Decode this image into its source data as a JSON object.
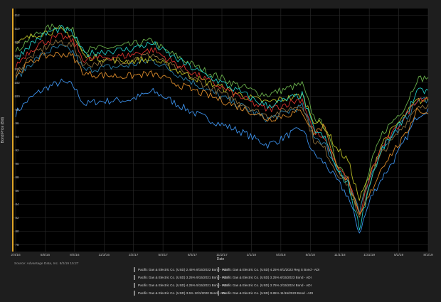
{
  "chart_data": {
    "type": "line",
    "xlabel": "Date",
    "ylabel": "Bond Price (Bid)",
    "source": "Source: Advantage Data, Inc. 8/2/19 15:27",
    "x_ticks": [
      "2/4/16",
      "5/5/16",
      "8/4/16",
      "11/3/16",
      "2/2/17",
      "5/4/17",
      "8/3/17",
      "11/2/17",
      "2/1/18",
      "5/3/18",
      "8/2/18",
      "11/1/18",
      "1/31/19",
      "5/2/19",
      "8/1/19"
    ],
    "y_ticks": [
      78,
      80,
      82,
      84,
      86,
      88,
      90,
      92,
      94,
      96,
      98,
      100,
      102,
      104,
      106,
      108,
      110,
      112
    ],
    "ylim": [
      77,
      113
    ],
    "grid": true,
    "legend_position": "bottom",
    "series": [
      {
        "name": "Pacific Gas & Electric Co. (USD) 2.45% 8/15/2022 Bond - ADI",
        "color": "#3b8fe8",
        "values": [
          97.5,
          99.3,
          100.6,
          101.5,
          102.1,
          101.6,
          98.8,
          99.2,
          99.3,
          99.4,
          99.5,
          100.1,
          100.7,
          99.9,
          98.9,
          98.0,
          97.2,
          96.5,
          95.8,
          95.2,
          94.5,
          93.6,
          92.8,
          93.5,
          94.5,
          95.2,
          91.5,
          90.0,
          87.6,
          85.2,
          79.8,
          85.0,
          88.0,
          90.5,
          93.5,
          97.0,
          98.2
        ]
      },
      {
        "name": "Pacific Gas & Electric Co. (USD) 4.25% 8/1/2023 Reg S Bond - ADI",
        "color": "#6ab04c",
        "values": [
          106.5,
          108.3,
          109.4,
          110.2,
          110.5,
          109.7,
          106.8,
          107.0,
          107.2,
          107.3,
          107.6,
          108.0,
          108.2,
          106.8,
          106.0,
          105.1,
          104.2,
          103.4,
          102.7,
          101.9,
          101.3,
          100.6,
          100.2,
          100.8,
          101.3,
          101.8,
          97.0,
          95.5,
          90.3,
          88.0,
          82.6,
          90.0,
          94.5,
          96.5,
          98.5,
          102.5,
          102.8
        ]
      },
      {
        "name": "Pacific Gas & Electric Co. (USD) 3.25% 9/15/2021 Bond - ADI",
        "color": "#2b7fa8",
        "values": [
          102.5,
          104.4,
          105.8,
          106.8,
          107.3,
          106.6,
          103.8,
          104.1,
          104.3,
          104.4,
          104.6,
          105.0,
          105.3,
          104.4,
          103.4,
          102.5,
          101.6,
          100.7,
          99.9,
          99.1,
          98.3,
          97.4,
          96.6,
          97.2,
          97.9,
          98.5,
          94.3,
          92.8,
          89.4,
          87.5,
          82.7,
          88.6,
          92.4,
          94.4,
          96.6,
          99.3,
          99.6
        ]
      },
      {
        "name": "Pacific Gas & Electric Co. (USD) 3.25% 6/15/2023 Bond - ADI",
        "color": "#8a6d3b",
        "values": [
          103.4,
          105.3,
          106.7,
          107.6,
          108.1,
          107.4,
          104.6,
          104.9,
          105.1,
          105.2,
          105.4,
          105.9,
          106.2,
          105.0,
          104.1,
          103.1,
          102.2,
          101.2,
          100.4,
          99.6,
          98.8,
          97.8,
          97.1,
          97.6,
          98.2,
          98.8,
          93.6,
          92.1,
          88.8,
          86.9,
          81.6,
          87.9,
          91.7,
          93.7,
          95.9,
          98.5,
          98.8
        ]
      },
      {
        "name": "Pacific Gas & Electric Co. (USD) 4.25% 5/15/2021 Bond - ADI",
        "color": "#b5b824",
        "values": [
          107.6,
          108.6,
          109.3,
          109.6,
          109.7,
          109.0,
          105.9,
          105.7,
          105.5,
          105.3,
          105.2,
          105.4,
          105.5,
          104.7,
          103.9,
          103.2,
          102.5,
          101.9,
          101.3,
          100.6,
          100.0,
          99.5,
          99.1,
          99.5,
          99.8,
          100.2,
          96.5,
          95.4,
          92.3,
          90.5,
          84.7,
          88.7,
          93.2,
          95.3,
          97.2,
          99.3,
          99.4
        ]
      },
      {
        "name": "Pacific Gas & Electric Co. (USD) 3.75% 2/15/2024 Bond - ADI",
        "color": "#d6322c",
        "values": [
          104.5,
          106.4,
          107.7,
          108.4,
          108.9,
          108.2,
          105.3,
          105.6,
          105.8,
          105.9,
          106.1,
          106.6,
          106.9,
          105.8,
          104.8,
          103.9,
          103.0,
          102.1,
          101.3,
          100.4,
          99.6,
          98.7,
          98.0,
          98.5,
          99.1,
          99.6,
          94.9,
          93.4,
          89.9,
          87.7,
          82.3,
          88.7,
          92.6,
          94.7,
          97.0,
          99.6,
          99.8
        ]
      },
      {
        "name": "Pacific Gas & Electric Co. (USD) 3.5% 10/1/2020 Bond - ADI",
        "color": "#d9892a",
        "values": [
          103.0,
          104.7,
          105.7,
          106.1,
          106.3,
          105.9,
          103.3,
          103.2,
          103.1,
          103.0,
          103.0,
          103.2,
          103.3,
          102.6,
          101.9,
          101.2,
          100.6,
          100.0,
          99.4,
          98.7,
          98.1,
          97.4,
          96.6,
          97.0,
          97.4,
          97.8,
          94.6,
          95.7,
          89.4,
          87.6,
          82.1,
          85.8,
          89.7,
          92.0,
          94.1,
          98.1,
          97.4
        ]
      },
      {
        "name": "Pacific Gas & Electric Co. (USD) 3.85% 11/15/2023 Bond - ADI",
        "color": "#1ec7c0",
        "values": [
          105.4,
          107.3,
          108.6,
          109.6,
          110.0,
          109.3,
          106.2,
          106.5,
          106.7,
          106.8,
          107.0,
          107.5,
          107.8,
          106.6,
          105.6,
          104.6,
          103.7,
          102.8,
          102.0,
          101.1,
          100.3,
          99.3,
          98.6,
          99.1,
          99.7,
          100.2,
          95.2,
          93.7,
          89.2,
          87.0,
          80.6,
          87.7,
          92.2,
          94.5,
          97.1,
          100.6,
          100.9
        ]
      }
    ]
  }
}
